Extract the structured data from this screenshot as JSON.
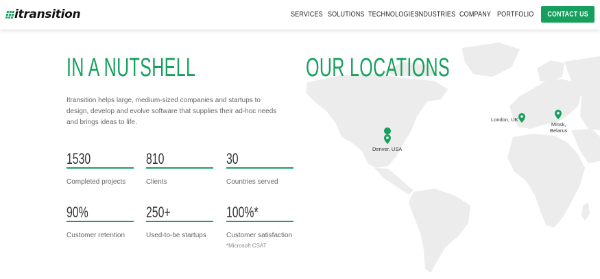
{
  "header": {
    "logo_text": "itransition",
    "nav": [
      "SERVICES",
      "SOLUTIONS",
      "TECHNOLOGIES",
      "INDUSTRIES",
      "COMPANY",
      "PORTFOLIO"
    ],
    "contact_label": "CONTACT US"
  },
  "nutshell": {
    "title": "IN A NUTSHELL",
    "intro": "Itransition helps large, medium-sized companies and startups to design, develop and evolve software that supplies their ad-hoc needs and brings ideas to life.",
    "stats": [
      {
        "value": "1530",
        "label": "Completed projects"
      },
      {
        "value": "810",
        "label": "Clients"
      },
      {
        "value": "30",
        "label": "Countries served"
      },
      {
        "value": "90%",
        "label": "Customer retention"
      },
      {
        "value": "250+",
        "label": "Used-to-be startups"
      },
      {
        "value": "100%*",
        "label": "Customer satisfaction",
        "note": "*Microsoft CSAT"
      }
    ]
  },
  "locations": {
    "title": "OUR LOCATIONS",
    "pins": [
      {
        "label": "Denver, USA"
      },
      {
        "label": "London, UK"
      },
      {
        "label": "Minsk,\nBelarus"
      }
    ]
  },
  "colors": {
    "accent": "#17a05d",
    "map_land": "#ececec",
    "text_muted": "#666666"
  },
  "icons": {
    "pin": "map-pin-icon"
  }
}
